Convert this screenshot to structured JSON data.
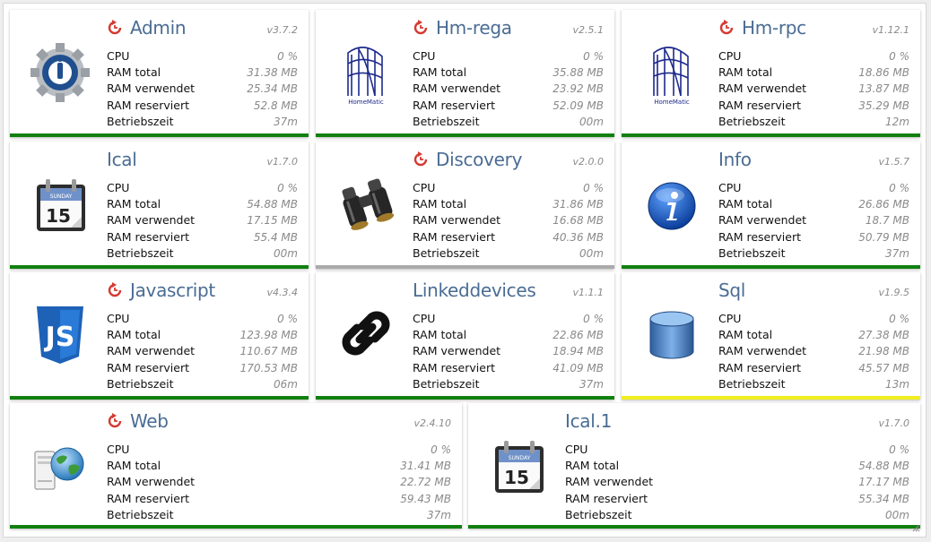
{
  "stat_labels": {
    "cpu": "CPU",
    "ram_total": "RAM total",
    "ram_used": "RAM verwendet",
    "ram_reserved": "RAM reserviert",
    "uptime": "Betriebszeit"
  },
  "status_colors": {
    "ok": "#11800f",
    "off": "#aaaaaa",
    "warn": "#f0ee1e"
  },
  "adapters": [
    {
      "title": "Admin",
      "version": "v3.7.2",
      "icon": "admin-gear-icon",
      "restart": true,
      "cpu": "0 %",
      "ram_total": "31.38 MB",
      "ram_used": "25.34 MB",
      "ram_reserved": "52.8 MB",
      "uptime": "37m",
      "status": "ok"
    },
    {
      "title": "Hm-rega",
      "version": "v2.5.1",
      "icon": "homematic-logo-icon",
      "icon_text": "HomeMatic",
      "restart": true,
      "cpu": "0 %",
      "ram_total": "35.88 MB",
      "ram_used": "23.92 MB",
      "ram_reserved": "52.09 MB",
      "uptime": "00m",
      "status": "ok"
    },
    {
      "title": "Hm-rpc",
      "version": "v1.12.1",
      "icon": "homematic-logo-icon",
      "icon_text": "HomeMatic",
      "restart": true,
      "cpu": "0 %",
      "ram_total": "18.86 MB",
      "ram_used": "13.87 MB",
      "ram_reserved": "35.29 MB",
      "uptime": "12m",
      "status": "ok"
    },
    {
      "title": "Ical",
      "version": "v1.7.0",
      "icon": "calendar-icon",
      "icon_day": "SUNDAY",
      "icon_date": "15",
      "restart": false,
      "cpu": "0 %",
      "ram_total": "54.88 MB",
      "ram_used": "17.15 MB",
      "ram_reserved": "55.4 MB",
      "uptime": "00m",
      "status": "ok"
    },
    {
      "title": "Discovery",
      "version": "v2.0.0",
      "icon": "binoculars-icon",
      "restart": true,
      "cpu": "0 %",
      "ram_total": "31.86 MB",
      "ram_used": "16.68 MB",
      "ram_reserved": "40.36 MB",
      "uptime": "00m",
      "status": "off"
    },
    {
      "title": "Info",
      "version": "v1.5.7",
      "icon": "info-icon",
      "restart": false,
      "cpu": "0 %",
      "ram_total": "26.86 MB",
      "ram_used": "18.7 MB",
      "ram_reserved": "50.79 MB",
      "uptime": "37m",
      "status": "ok"
    },
    {
      "title": "Javascript",
      "version": "v4.3.4",
      "icon": "javascript-shield-icon",
      "icon_text": "JS",
      "restart": true,
      "cpu": "0 %",
      "ram_total": "123.98 MB",
      "ram_used": "110.67 MB",
      "ram_reserved": "170.53 MB",
      "uptime": "06m",
      "status": "ok"
    },
    {
      "title": "Linkeddevices",
      "version": "v1.1.1",
      "icon": "chain-link-icon",
      "restart": false,
      "cpu": "0 %",
      "ram_total": "22.86 MB",
      "ram_used": "18.94 MB",
      "ram_reserved": "41.09 MB",
      "uptime": "37m",
      "status": "ok"
    },
    {
      "title": "Sql",
      "version": "v1.9.5",
      "icon": "database-icon",
      "restart": false,
      "cpu": "0 %",
      "ram_total": "27.38 MB",
      "ram_used": "21.98 MB",
      "ram_reserved": "45.57 MB",
      "uptime": "13m",
      "status": "warn"
    },
    {
      "title": "Web",
      "version": "v2.4.10",
      "icon": "web-server-globe-icon",
      "restart": true,
      "cpu": "0 %",
      "ram_total": "31.41 MB",
      "ram_used": "22.72 MB",
      "ram_reserved": "59.43 MB",
      "uptime": "37m",
      "status": "ok"
    },
    {
      "title": "Ical.1",
      "version": "v1.7.0",
      "icon": "calendar-icon",
      "icon_day": "SUNDAY",
      "icon_date": "15",
      "restart": false,
      "cpu": "0 %",
      "ram_total": "54.88 MB",
      "ram_used": "17.17 MB",
      "ram_reserved": "55.34 MB",
      "uptime": "00m",
      "status": "ok"
    }
  ]
}
